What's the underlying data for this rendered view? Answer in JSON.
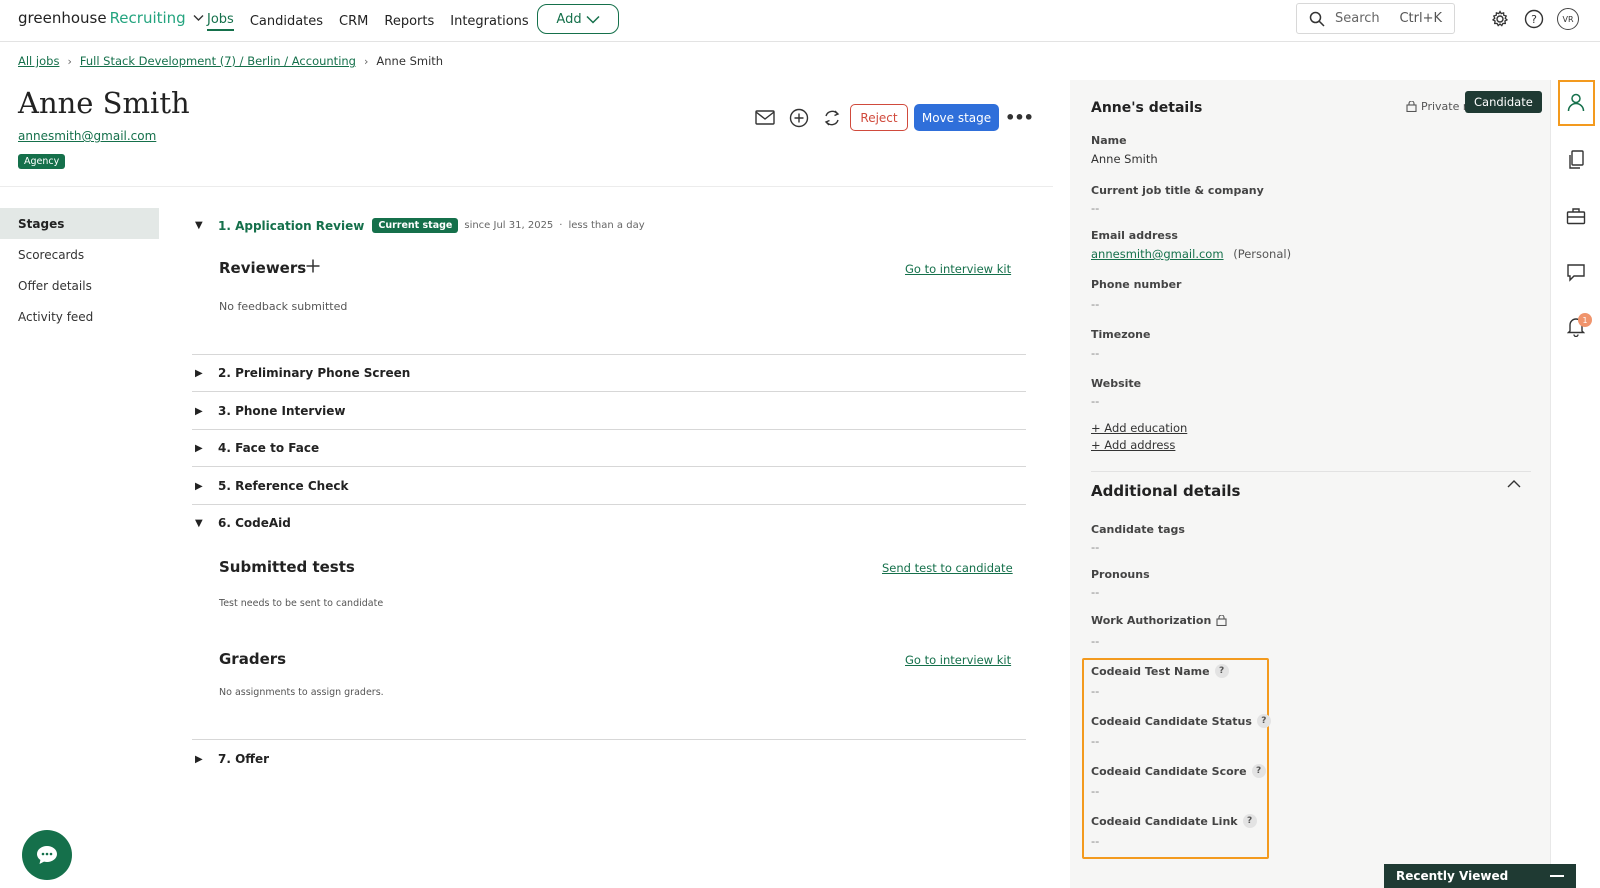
{
  "topnav": {
    "brand": "greenhouse",
    "brand_sub": "Recruiting",
    "links": [
      "Jobs",
      "Candidates",
      "CRM",
      "Reports",
      "Integrations"
    ],
    "add_label": "Add",
    "search_placeholder": "Search",
    "search_shortcut": "Ctrl+K",
    "avatar_initials": "VR"
  },
  "breadcrumb": {
    "all_jobs": "All jobs",
    "job": "Full Stack Development (7) / Berlin / Accounting",
    "current": "Anne Smith"
  },
  "candidate": {
    "name": "Anne Smith",
    "email": "annesmith@gmail.com",
    "badge": "Agency"
  },
  "actions": {
    "reject": "Reject",
    "move_stage": "Move stage",
    "more": "•••"
  },
  "subnav": [
    "Stages",
    "Scorecards",
    "Offer details",
    "Activity feed"
  ],
  "stages": {
    "s1": {
      "label": "1. Application Review",
      "badge": "Current stage",
      "since": "since Jul 31, 2025",
      "dot": "·",
      "duration": "less than a day"
    },
    "reviewers_title": "Reviewers",
    "reviewers_link": "Go to interview kit",
    "no_feedback": "No feedback submitted",
    "s2": "2. Preliminary Phone Screen",
    "s3": "3. Phone Interview",
    "s4": "4. Face to Face",
    "s5": "5. Reference Check",
    "s6": "6. CodeAid",
    "submitted_title": "Submitted tests",
    "send_test_link": "Send test to candidate",
    "test_note": "Test needs to be sent to candidate",
    "graders_title": "Graders",
    "graders_link": "Go to interview kit",
    "graders_note": "No assignments to assign graders.",
    "s7": "7. Offer"
  },
  "details": {
    "title": "Anne's details",
    "private_note": "Private n",
    "tooltip": "Candidate",
    "name_label": "Name",
    "name_value": "Anne Smith",
    "job_label": "Current job title & company",
    "job_value": "--",
    "email_label": "Email address",
    "email_value": "annesmith@gmail.com",
    "email_type": "(Personal)",
    "phone_label": "Phone number",
    "phone_value": "--",
    "tz_label": "Timezone",
    "tz_value": "--",
    "website_label": "Website",
    "website_value": "--",
    "add_education": "+ Add education",
    "add_address": "+ Add address"
  },
  "additional": {
    "title": "Additional details",
    "tags_label": "Candidate tags",
    "tags_value": "--",
    "pronouns_label": "Pronouns",
    "pronouns_value": "--",
    "workauth_label": "Work Authorization",
    "workauth_value": "--",
    "test_name_label": "Codeaid Test Name",
    "test_name_value": "--",
    "status_label": "Codeaid Candidate Status",
    "status_value": "--",
    "score_label": "Codeaid Candidate Score",
    "score_value": "--",
    "link_label": "Codeaid Candidate Link",
    "link_value": "--",
    "help": "?"
  },
  "rail": {
    "notif_count": "1"
  },
  "recent": {
    "label": "Recently Viewed"
  },
  "colors": {
    "brand_green": "#15704b",
    "primary_blue": "#2f6fda",
    "reject_red": "#d04a3c",
    "highlight_orange": "#f39a1e"
  }
}
